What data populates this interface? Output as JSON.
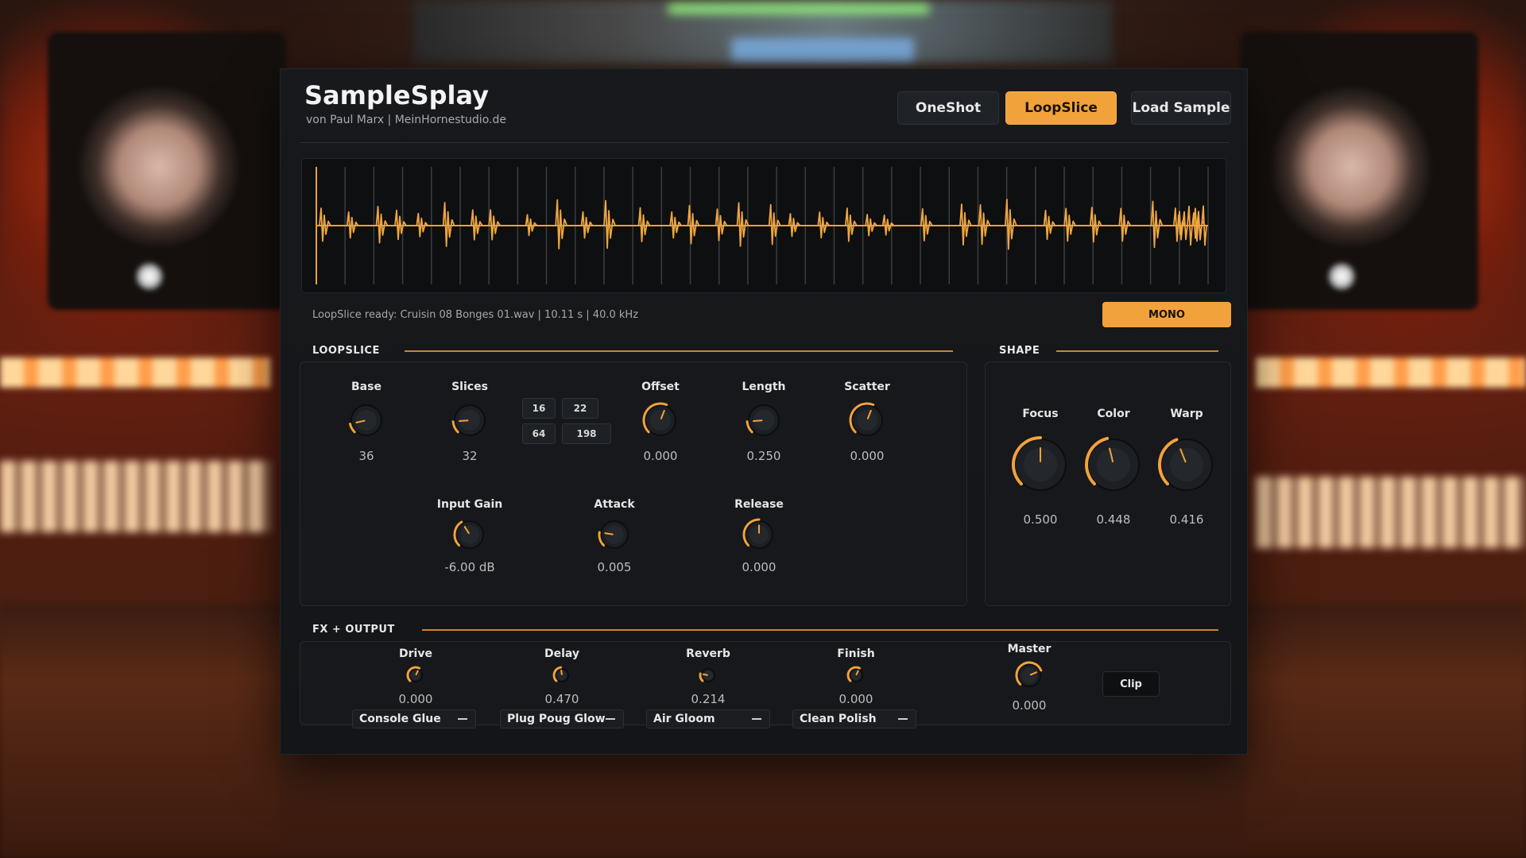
{
  "app": {
    "title": "SampleSplay",
    "subtitle": "von Paul Marx | MeinHornestudio.de"
  },
  "mode_buttons": [
    {
      "label": "OneShot",
      "active": false
    },
    {
      "label": "LoopSlice",
      "active": true
    },
    {
      "label": "Load Sample",
      "active": false
    }
  ],
  "status": {
    "text": "LoopSlice ready: Cruisin 08 Bonges 01.wav | 10.11 s | 40.0 kHz",
    "mono_label": "MONO"
  },
  "colors": {
    "accent": "#f2a23a",
    "panel": "#16181b",
    "bg": "#131518"
  },
  "loopslice": {
    "title": "LOOPSLICE",
    "knobs_row1": [
      {
        "label": "Base",
        "value": "36",
        "fraction": 0.12
      },
      {
        "label": "Slices",
        "value": "32",
        "fraction": 0.15
      },
      {
        "label": "Offset",
        "value": "0.000",
        "fraction": 0.58
      },
      {
        "label": "Length",
        "value": "0.250",
        "fraction": 0.15
      },
      {
        "label": "Scatter",
        "value": "0.000",
        "fraction": 0.58
      }
    ],
    "slice_presets": [
      "16",
      "22",
      "64",
      "198"
    ],
    "knobs_row2": [
      {
        "label": "Input Gain",
        "value": "-6.00 dB",
        "fraction": 0.38
      },
      {
        "label": "Attack",
        "value": "0.005",
        "fraction": 0.2
      },
      {
        "label": "Release",
        "value": "0.000",
        "fraction": 0.5
      }
    ]
  },
  "shape": {
    "title": "SHAPE",
    "knobs": [
      {
        "label": "Focus",
        "value": "0.500",
        "fraction": 0.5
      },
      {
        "label": "Color",
        "value": "0.448",
        "fraction": 0.45
      },
      {
        "label": "Warp",
        "value": "0.416",
        "fraction": 0.42
      }
    ]
  },
  "fx": {
    "title": "FX + OUTPUT",
    "units": [
      {
        "label": "Drive",
        "value": "0.000",
        "preset": "Console Glue",
        "fraction": 0.6
      },
      {
        "label": "Delay",
        "value": "0.470",
        "preset": "Plug Poug Glow",
        "fraction": 0.47
      },
      {
        "label": "Reverb",
        "value": "0.214",
        "preset": "Air Gloom",
        "fraction": 0.21
      },
      {
        "label": "Finish",
        "value": "0.000",
        "preset": "Clean Polish",
        "fraction": 0.6
      }
    ],
    "master": {
      "label": "Master",
      "value": "0.000",
      "fraction": 0.75
    },
    "clip_label": "Clip"
  }
}
